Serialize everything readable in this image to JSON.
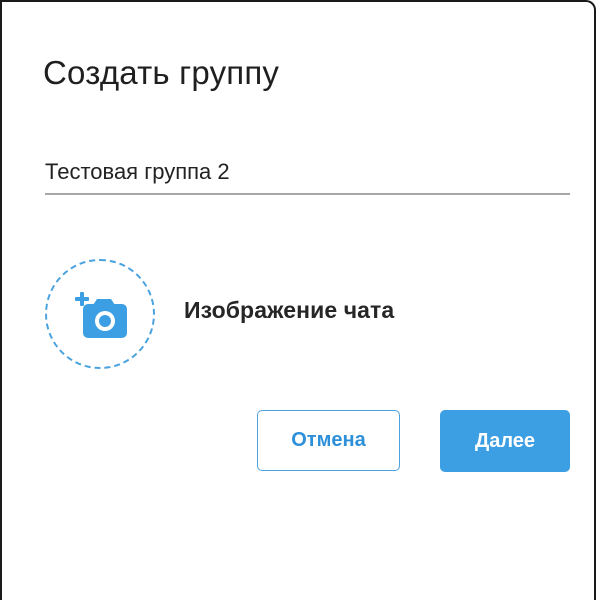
{
  "dialog": {
    "title": "Создать группу",
    "group_name": {
      "value": "Тестовая группа 2",
      "placeholder": ""
    },
    "avatar": {
      "label": "Изображение чата",
      "icon": "add-photo-icon"
    },
    "buttons": {
      "cancel_label": "Отмена",
      "next_label": "Далее"
    }
  },
  "colors": {
    "accent": "#3d9fe3",
    "accent_outline": "#4ea2df",
    "text_primary": "#1f1f1f",
    "underline": "#a7a7a7"
  }
}
